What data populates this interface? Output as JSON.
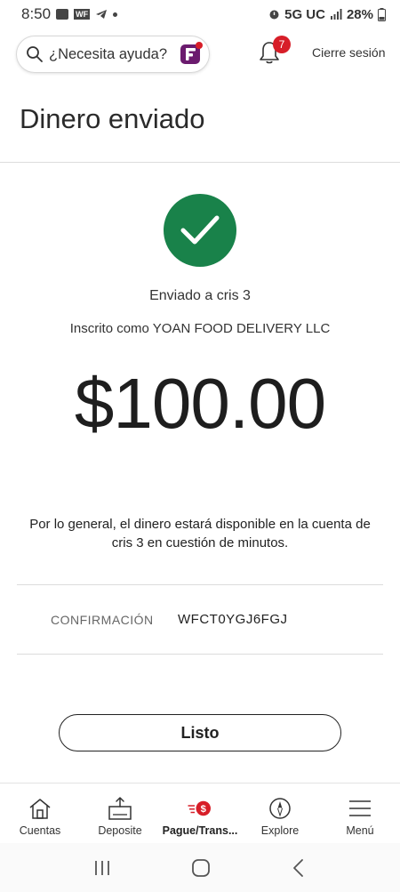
{
  "status_bar": {
    "time": "8:50",
    "network": "5G UC",
    "battery": "28%"
  },
  "header": {
    "search_placeholder": "¿Necesita ayuda?",
    "notification_count": "7",
    "logout_label": "Cierre sesión"
  },
  "page": {
    "title": "Dinero enviado"
  },
  "confirmation": {
    "sent_to": "Enviado a cris 3",
    "enrolled_as": "Inscrito como YOAN FOOD DELIVERY LLC",
    "amount": "$100.00",
    "availability_note": "Por lo general, el dinero estará disponible en la cuenta de cris 3 en cuestión de minutos.",
    "confirmation_label": "CONFIRMACIÓN",
    "confirmation_code": "WFCT0YGJ6FGJ",
    "done_label": "Listo"
  },
  "bottom_nav": {
    "items": [
      {
        "label": "Cuentas",
        "icon": "home-icon"
      },
      {
        "label": "Deposite",
        "icon": "deposit-icon"
      },
      {
        "label": "Pague/Trans...",
        "icon": "pay-transfer-icon"
      },
      {
        "label": "Explore",
        "icon": "compass-icon"
      },
      {
        "label": "Menú",
        "icon": "menu-icon"
      }
    ],
    "active_index": 2
  },
  "colors": {
    "success_green": "#19824a",
    "brand_red": "#d71e28",
    "fargo_purple": "#6b1b6e"
  }
}
